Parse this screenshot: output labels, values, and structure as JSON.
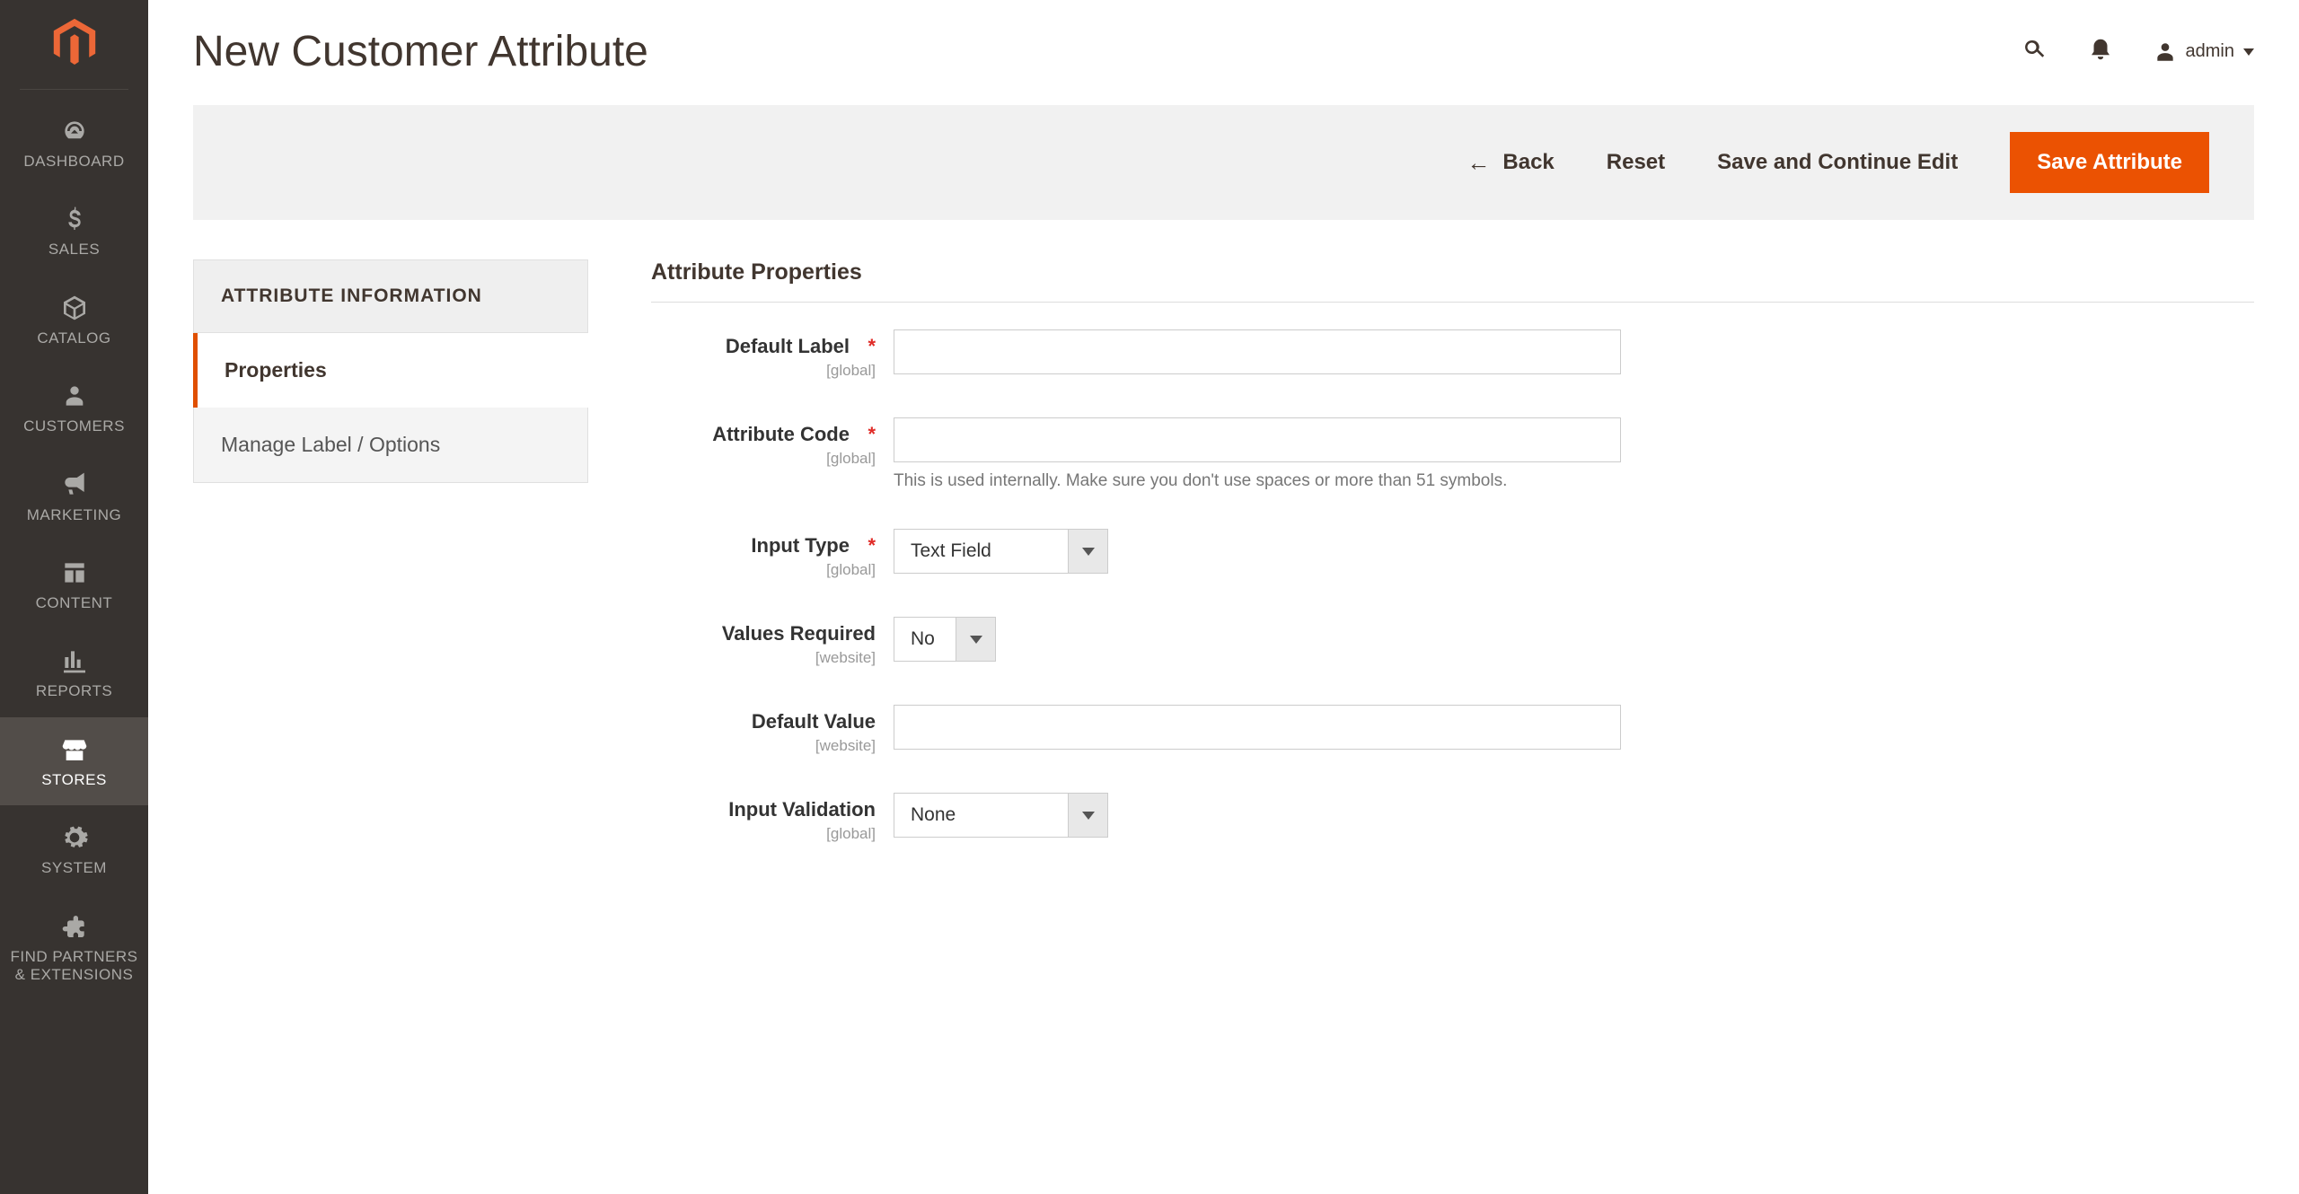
{
  "sidebar": {
    "items": [
      {
        "label": "DASHBOARD",
        "icon": "dashboard"
      },
      {
        "label": "SALES",
        "icon": "dollar"
      },
      {
        "label": "CATALOG",
        "icon": "box"
      },
      {
        "label": "CUSTOMERS",
        "icon": "person"
      },
      {
        "label": "MARKETING",
        "icon": "megaphone"
      },
      {
        "label": "CONTENT",
        "icon": "layout"
      },
      {
        "label": "REPORTS",
        "icon": "bars"
      },
      {
        "label": "STORES",
        "icon": "store",
        "active": true
      },
      {
        "label": "SYSTEM",
        "icon": "gear"
      },
      {
        "label": "FIND PARTNERS & EXTENSIONS",
        "icon": "puzzle"
      }
    ]
  },
  "header": {
    "title": "New Customer Attribute",
    "admin_label": "admin"
  },
  "actions": {
    "back": "Back",
    "reset": "Reset",
    "save_continue": "Save and Continue Edit",
    "save": "Save Attribute"
  },
  "side_panel": {
    "heading": "ATTRIBUTE INFORMATION",
    "tabs": [
      {
        "label": "Properties",
        "active": true
      },
      {
        "label": "Manage Label / Options",
        "active": false
      }
    ]
  },
  "form": {
    "section_title": "Attribute Properties",
    "fields": {
      "default_label": {
        "label": "Default Label",
        "scope": "[global]",
        "required": true,
        "value": ""
      },
      "attribute_code": {
        "label": "Attribute Code",
        "scope": "[global]",
        "required": true,
        "value": "",
        "help": "This is used internally. Make sure you don't use spaces or more than 51 symbols."
      },
      "input_type": {
        "label": "Input Type",
        "scope": "[global]",
        "required": true,
        "value": "Text Field"
      },
      "values_required": {
        "label": "Values Required",
        "scope": "[website]",
        "value": "No"
      },
      "default_value": {
        "label": "Default Value",
        "scope": "[website]",
        "value": ""
      },
      "input_validation": {
        "label": "Input Validation",
        "scope": "[global]",
        "value": "None"
      }
    }
  }
}
